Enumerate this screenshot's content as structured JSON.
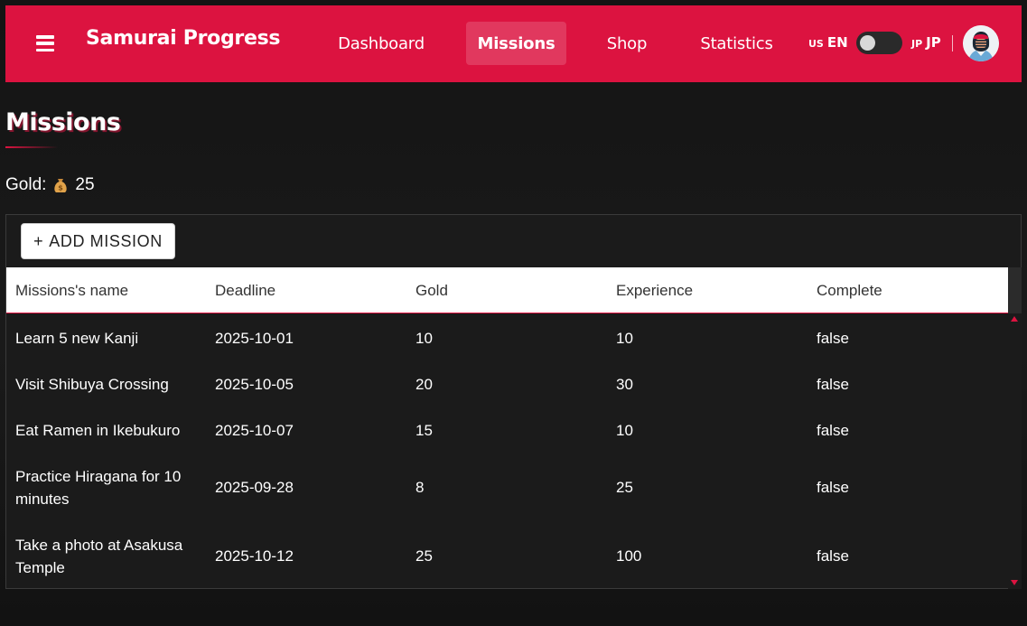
{
  "app": {
    "title": "Samurai Progress"
  },
  "nav": {
    "items": [
      {
        "label": "Dashboard",
        "active": false
      },
      {
        "label": "Missions",
        "active": true
      },
      {
        "label": "Shop",
        "active": false
      },
      {
        "label": "Statistics",
        "active": false
      }
    ]
  },
  "language": {
    "en_code": "US",
    "en_label": "EN",
    "jp_code": "JP",
    "jp_label": "JP",
    "toggle_state": "off"
  },
  "page": {
    "title": "Missions",
    "gold_label": "Gold:",
    "gold_value": "25"
  },
  "toolbar": {
    "add_label": "ADD MISSION",
    "add_icon": "+"
  },
  "table": {
    "columns": [
      "Missions's name",
      "Deadline",
      "Gold",
      "Experience",
      "Complete"
    ],
    "rows": [
      {
        "name": "Learn 5 new Kanji",
        "deadline": "2025-10-01",
        "gold": "10",
        "experience": "10",
        "complete": "false"
      },
      {
        "name": "Visit Shibuya Crossing",
        "deadline": "2025-10-05",
        "gold": "20",
        "experience": "30",
        "complete": "false"
      },
      {
        "name": "Eat Ramen in Ikebukuro",
        "deadline": "2025-10-07",
        "gold": "15",
        "experience": "10",
        "complete": "false"
      },
      {
        "name": "Practice Hiragana for 10 minutes",
        "deadline": "2025-09-28",
        "gold": "8",
        "experience": "25",
        "complete": "false"
      },
      {
        "name": "Take a photo at Asakusa Temple",
        "deadline": "2025-10-12",
        "gold": "25",
        "experience": "100",
        "complete": "false"
      }
    ]
  },
  "colors": {
    "accent": "#dc1340",
    "background": "#151515",
    "panel": "#1b1b1b",
    "header_bg": "#ffffff"
  },
  "icons": {
    "menu": "hamburger-icon",
    "gold": "money-bag-icon",
    "avatar": "samurai-avatar"
  }
}
